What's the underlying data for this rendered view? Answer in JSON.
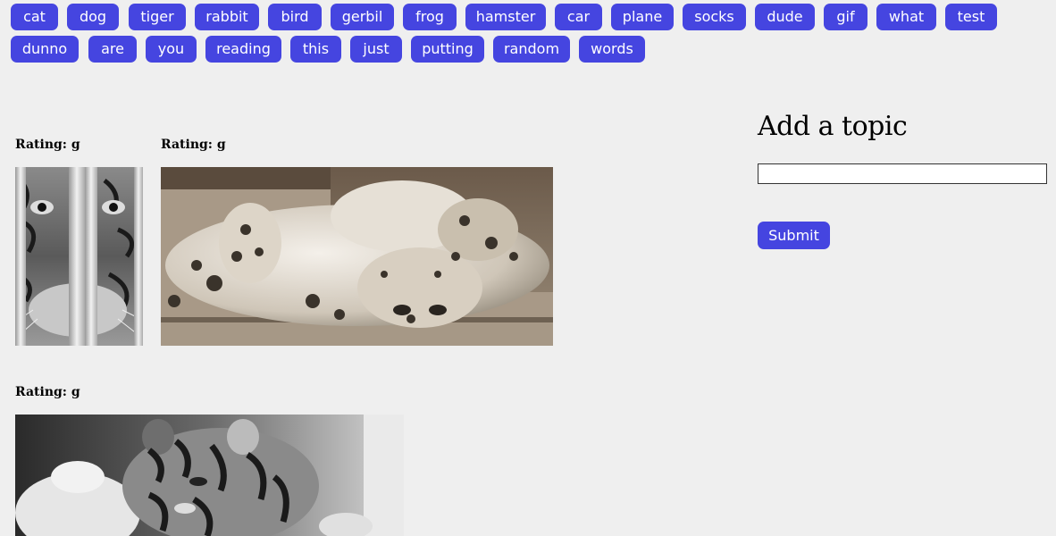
{
  "topics": [
    "cat",
    "dog",
    "tiger",
    "rabbit",
    "bird",
    "gerbil",
    "frog",
    "hamster",
    "car",
    "plane",
    "socks",
    "dude",
    "gif",
    "what",
    "test",
    "dunno",
    "are",
    "you",
    "reading",
    "this",
    "just",
    "putting",
    "random",
    "words"
  ],
  "gifs": [
    {
      "rating_label": "Rating: g",
      "alt": "tiger behind bars"
    },
    {
      "rating_label": "Rating: g",
      "alt": "snow leopard rolling on back"
    },
    {
      "rating_label": "Rating: g",
      "alt": "tiger cub with stuffed toy"
    }
  ],
  "form": {
    "heading": "Add a topic",
    "input_value": "",
    "submit_label": "Submit"
  },
  "colors": {
    "button_bg": "#4545e0",
    "button_text": "#ffffff",
    "page_bg": "#efefef"
  }
}
